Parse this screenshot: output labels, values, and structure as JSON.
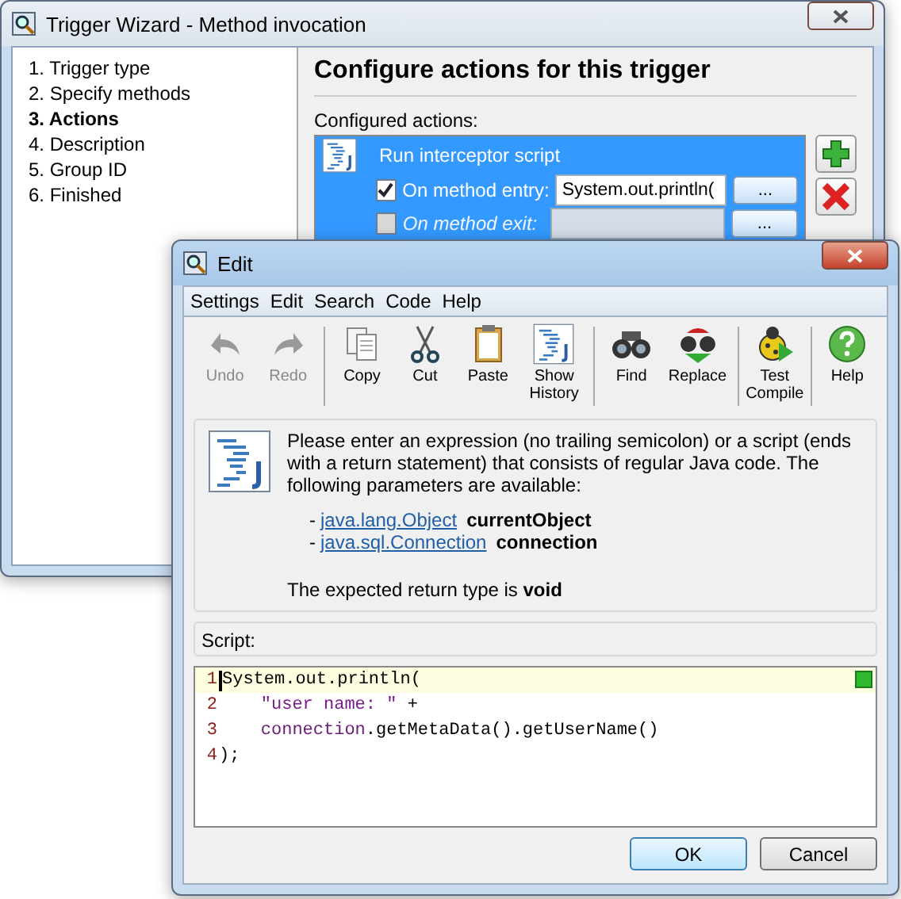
{
  "wizard": {
    "title": "Trigger Wizard - Method invocation",
    "steps": [
      {
        "label": "1. Trigger type",
        "selected": false
      },
      {
        "label": "2. Specify methods",
        "selected": false
      },
      {
        "label": "3. Actions",
        "selected": true
      },
      {
        "label": "4. Description",
        "selected": false
      },
      {
        "label": "5. Group ID",
        "selected": false
      },
      {
        "label": "6. Finished",
        "selected": false
      }
    ],
    "heading": "Configure actions for this trigger",
    "actions_label": "Configured actions:",
    "action": {
      "name": "Run interceptor script",
      "selected": true,
      "options": [
        {
          "label": "On method entry:",
          "checked": true,
          "disabled": false,
          "value": "System.out.println(",
          "button": "..."
        },
        {
          "label": "On method exit:",
          "checked": false,
          "disabled": true,
          "button": "..."
        }
      ]
    }
  },
  "editor": {
    "title": "Edit",
    "menu": [
      "Settings",
      "Edit",
      "Search",
      "Code",
      "Help"
    ],
    "toolbar": [
      [
        {
          "kind": "undo",
          "label": "Undo",
          "disabled": true
        },
        {
          "kind": "redo",
          "label": "Redo",
          "disabled": true
        }
      ],
      [
        {
          "kind": "copy",
          "label": "Copy",
          "disabled": false
        },
        {
          "kind": "cut",
          "label": "Cut",
          "disabled": false
        },
        {
          "kind": "paste",
          "label": "Paste",
          "disabled": false
        },
        {
          "kind": "history",
          "label": "Show History",
          "disabled": false
        }
      ],
      [
        {
          "kind": "find",
          "label": "Find",
          "disabled": false
        },
        {
          "kind": "replace",
          "label": "Replace",
          "disabled": false
        }
      ],
      [
        {
          "kind": "compile",
          "label": "Test Compile",
          "disabled": false
        }
      ],
      [
        {
          "kind": "help",
          "label": "Help",
          "disabled": false
        }
      ]
    ],
    "intro": "Please enter an expression (no trailing semicolon) or a script (ends with a return statement) that consists of regular Java code. The following parameters are available:",
    "parameters": [
      {
        "dash": "-",
        "type": "java.lang.Object",
        "name": "currentObject"
      },
      {
        "dash": "-",
        "type": "java.sql.Connection",
        "name": "connection"
      }
    ],
    "return_note": "The expected return type is **void**",
    "script_label": "Script:",
    "lines": [
      {
        "number": "1",
        "current": true,
        "indented": false,
        "tokens": [
          {
            "kind": "plain",
            "text": "System.out.println("
          }
        ]
      },
      {
        "number": "2",
        "current": false,
        "indented": true,
        "tokens": [
          {
            "kind": "string",
            "text": "\"user name: \""
          },
          {
            "kind": "plain",
            "text": " +"
          }
        ]
      },
      {
        "number": "3",
        "current": false,
        "indented": true,
        "tokens": [
          {
            "kind": "variable",
            "text": "connection"
          },
          {
            "kind": "plain",
            "text": ".getMetaData().getUserName()"
          }
        ]
      },
      {
        "number": "4",
        "current": false,
        "indented": false,
        "tokens": [
          {
            "kind": "plain",
            "text": ");"
          }
        ]
      }
    ],
    "buttons": [
      {
        "label": "OK",
        "default": true
      },
      {
        "label": "Cancel",
        "default": false
      }
    ]
  }
}
